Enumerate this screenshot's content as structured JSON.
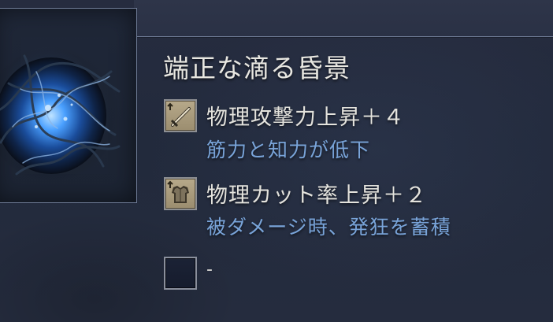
{
  "item": {
    "title": "端正な滴る昏景",
    "image_icon": "dark-crystal-orb-icon"
  },
  "effects": [
    {
      "icon": "sword-attack-up-icon",
      "name": "物理攻撃力上昇＋４",
      "description": "筋力と知力が低下"
    },
    {
      "icon": "armor-damage-cut-up-icon",
      "name": "物理カット率上昇＋２",
      "description": "被ダメージ時、発狂を蓄積"
    },
    {
      "icon": "empty-slot-icon",
      "name": "-"
    }
  ],
  "colors": {
    "title": "#e8e7e1",
    "effect_name": "#e4e3dd",
    "effect_description": "#79a4d9",
    "background": "#242b3e"
  }
}
